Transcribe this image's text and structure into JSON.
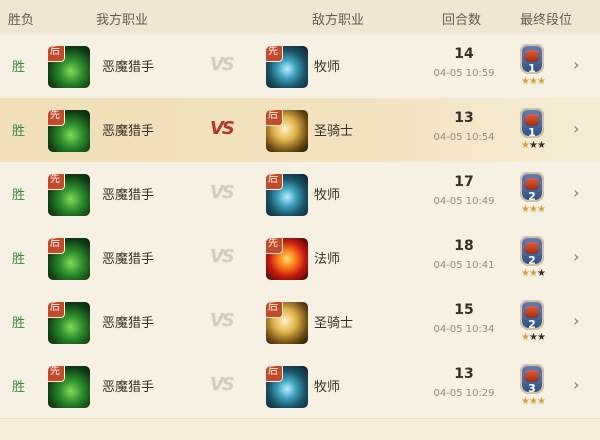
{
  "headers": {
    "result": "胜负",
    "my_class": "我方职业",
    "enemy_class": "敌方职业",
    "rounds": "回合数",
    "final_rank": "最终段位"
  },
  "vs_text": "VS",
  "chevron": "›",
  "rows": [
    {
      "result": "胜",
      "my_badge": "后",
      "my_class": "恶魔猎手",
      "enemy_badge": "先",
      "enemy_class": "牧师",
      "rounds": "14",
      "time": "04-05 10:59",
      "rank": "1",
      "stars": "★★★",
      "dim_stars": ""
    },
    {
      "result": "胜",
      "my_badge": "先",
      "my_class": "恶魔猎手",
      "enemy_badge": "后",
      "enemy_class": "圣骑士",
      "rounds": "13",
      "time": "04-05 10:54",
      "rank": "1",
      "stars": "★",
      "dim_stars": "★★"
    },
    {
      "result": "胜",
      "my_badge": "先",
      "my_class": "恶魔猎手",
      "enemy_badge": "后",
      "enemy_class": "牧师",
      "rounds": "17",
      "time": "04-05 10:49",
      "rank": "2",
      "stars": "★★★",
      "dim_stars": ""
    },
    {
      "result": "胜",
      "my_badge": "后",
      "my_class": "恶魔猎手",
      "enemy_badge": "先",
      "enemy_class": "法师",
      "rounds": "18",
      "time": "04-05 10:41",
      "rank": "2",
      "stars": "★★",
      "dim_stars": "★"
    },
    {
      "result": "胜",
      "my_badge": "后",
      "my_class": "恶魔猎手",
      "enemy_badge": "后",
      "enemy_class": "圣骑士",
      "rounds": "15",
      "time": "04-05 10:34",
      "rank": "2",
      "stars": "★",
      "dim_stars": "★★"
    },
    {
      "result": "胜",
      "my_badge": "先",
      "my_class": "恶魔猎手",
      "enemy_badge": "后",
      "enemy_class": "牧师",
      "rounds": "13",
      "time": "04-05 10:29",
      "rank": "3",
      "stars": "★★★",
      "dim_stars": ""
    }
  ],
  "class_icons": {
    "恶魔猎手": "demon-hunter-icon",
    "牧师": "priest-icon",
    "圣骑士": "paladin-icon",
    "法师": "mage-icon"
  },
  "colors": {
    "win_green": "#3f8a3a",
    "badge_red": "#c44a2a",
    "active_vs": "#b33a2a",
    "highlight_row": "#f0dfb8"
  }
}
